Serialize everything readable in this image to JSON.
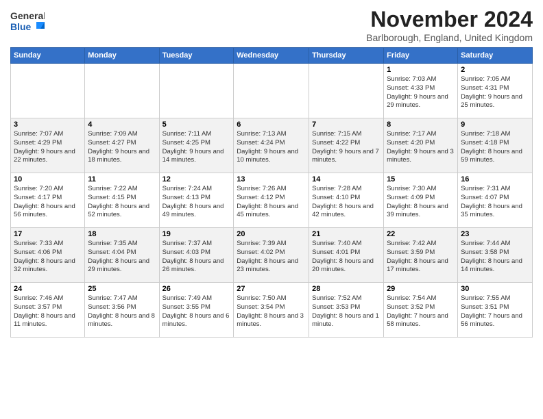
{
  "header": {
    "logo_general": "General",
    "logo_blue": "Blue",
    "month_title": "November 2024",
    "location": "Barlborough, England, United Kingdom"
  },
  "days_of_week": [
    "Sunday",
    "Monday",
    "Tuesday",
    "Wednesday",
    "Thursday",
    "Friday",
    "Saturday"
  ],
  "weeks": [
    [
      {
        "day": "",
        "info": ""
      },
      {
        "day": "",
        "info": ""
      },
      {
        "day": "",
        "info": ""
      },
      {
        "day": "",
        "info": ""
      },
      {
        "day": "",
        "info": ""
      },
      {
        "day": "1",
        "info": "Sunrise: 7:03 AM\nSunset: 4:33 PM\nDaylight: 9 hours and 29 minutes."
      },
      {
        "day": "2",
        "info": "Sunrise: 7:05 AM\nSunset: 4:31 PM\nDaylight: 9 hours and 25 minutes."
      }
    ],
    [
      {
        "day": "3",
        "info": "Sunrise: 7:07 AM\nSunset: 4:29 PM\nDaylight: 9 hours and 22 minutes."
      },
      {
        "day": "4",
        "info": "Sunrise: 7:09 AM\nSunset: 4:27 PM\nDaylight: 9 hours and 18 minutes."
      },
      {
        "day": "5",
        "info": "Sunrise: 7:11 AM\nSunset: 4:25 PM\nDaylight: 9 hours and 14 minutes."
      },
      {
        "day": "6",
        "info": "Sunrise: 7:13 AM\nSunset: 4:24 PM\nDaylight: 9 hours and 10 minutes."
      },
      {
        "day": "7",
        "info": "Sunrise: 7:15 AM\nSunset: 4:22 PM\nDaylight: 9 hours and 7 minutes."
      },
      {
        "day": "8",
        "info": "Sunrise: 7:17 AM\nSunset: 4:20 PM\nDaylight: 9 hours and 3 minutes."
      },
      {
        "day": "9",
        "info": "Sunrise: 7:18 AM\nSunset: 4:18 PM\nDaylight: 8 hours and 59 minutes."
      }
    ],
    [
      {
        "day": "10",
        "info": "Sunrise: 7:20 AM\nSunset: 4:17 PM\nDaylight: 8 hours and 56 minutes."
      },
      {
        "day": "11",
        "info": "Sunrise: 7:22 AM\nSunset: 4:15 PM\nDaylight: 8 hours and 52 minutes."
      },
      {
        "day": "12",
        "info": "Sunrise: 7:24 AM\nSunset: 4:13 PM\nDaylight: 8 hours and 49 minutes."
      },
      {
        "day": "13",
        "info": "Sunrise: 7:26 AM\nSunset: 4:12 PM\nDaylight: 8 hours and 45 minutes."
      },
      {
        "day": "14",
        "info": "Sunrise: 7:28 AM\nSunset: 4:10 PM\nDaylight: 8 hours and 42 minutes."
      },
      {
        "day": "15",
        "info": "Sunrise: 7:30 AM\nSunset: 4:09 PM\nDaylight: 8 hours and 39 minutes."
      },
      {
        "day": "16",
        "info": "Sunrise: 7:31 AM\nSunset: 4:07 PM\nDaylight: 8 hours and 35 minutes."
      }
    ],
    [
      {
        "day": "17",
        "info": "Sunrise: 7:33 AM\nSunset: 4:06 PM\nDaylight: 8 hours and 32 minutes."
      },
      {
        "day": "18",
        "info": "Sunrise: 7:35 AM\nSunset: 4:04 PM\nDaylight: 8 hours and 29 minutes."
      },
      {
        "day": "19",
        "info": "Sunrise: 7:37 AM\nSunset: 4:03 PM\nDaylight: 8 hours and 26 minutes."
      },
      {
        "day": "20",
        "info": "Sunrise: 7:39 AM\nSunset: 4:02 PM\nDaylight: 8 hours and 23 minutes."
      },
      {
        "day": "21",
        "info": "Sunrise: 7:40 AM\nSunset: 4:01 PM\nDaylight: 8 hours and 20 minutes."
      },
      {
        "day": "22",
        "info": "Sunrise: 7:42 AM\nSunset: 3:59 PM\nDaylight: 8 hours and 17 minutes."
      },
      {
        "day": "23",
        "info": "Sunrise: 7:44 AM\nSunset: 3:58 PM\nDaylight: 8 hours and 14 minutes."
      }
    ],
    [
      {
        "day": "24",
        "info": "Sunrise: 7:46 AM\nSunset: 3:57 PM\nDaylight: 8 hours and 11 minutes."
      },
      {
        "day": "25",
        "info": "Sunrise: 7:47 AM\nSunset: 3:56 PM\nDaylight: 8 hours and 8 minutes."
      },
      {
        "day": "26",
        "info": "Sunrise: 7:49 AM\nSunset: 3:55 PM\nDaylight: 8 hours and 6 minutes."
      },
      {
        "day": "27",
        "info": "Sunrise: 7:50 AM\nSunset: 3:54 PM\nDaylight: 8 hours and 3 minutes."
      },
      {
        "day": "28",
        "info": "Sunrise: 7:52 AM\nSunset: 3:53 PM\nDaylight: 8 hours and 1 minute."
      },
      {
        "day": "29",
        "info": "Sunrise: 7:54 AM\nSunset: 3:52 PM\nDaylight: 7 hours and 58 minutes."
      },
      {
        "day": "30",
        "info": "Sunrise: 7:55 AM\nSunset: 3:51 PM\nDaylight: 7 hours and 56 minutes."
      }
    ]
  ]
}
